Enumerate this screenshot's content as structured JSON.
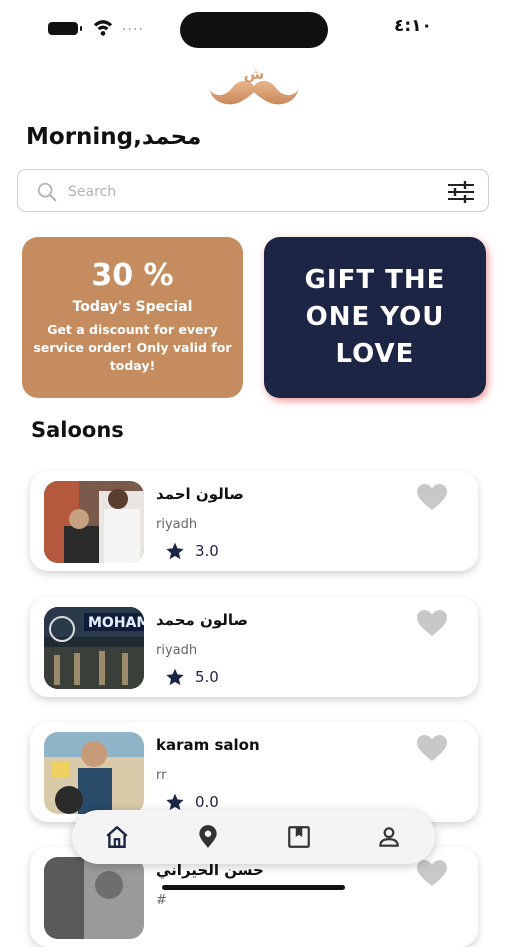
{
  "status_bar": {
    "time": "٤:١٠",
    "signal_dots": "...."
  },
  "header": {
    "greeting": "Morning,محمد"
  },
  "search": {
    "placeholder": "Search",
    "value": ""
  },
  "promos": {
    "discount": {
      "percent": "30 %",
      "title": "Today's Special",
      "description": "Get a discount for every service order! Only valid for today!"
    },
    "gift": {
      "text": "GIFT THE\nONE YOU\nLOVE"
    }
  },
  "section": {
    "title": "Saloons"
  },
  "saloons": [
    {
      "name": "صالون احمد",
      "city": "riyadh",
      "rating": "3.0"
    },
    {
      "name": "صالون محمد",
      "city": "riyadh",
      "rating": "5.0"
    },
    {
      "name": "karam salon",
      "city": "rr",
      "rating": "0.0"
    },
    {
      "name": "حسن الحيراني",
      "city": "#",
      "rating": ""
    }
  ],
  "nav": {
    "items": [
      {
        "icon": "home-icon"
      },
      {
        "icon": "location-icon"
      },
      {
        "icon": "bookmark-icon"
      },
      {
        "icon": "profile-icon"
      }
    ]
  },
  "colors": {
    "brand_tan": "#c58d5f",
    "navy": "#1d2544",
    "heart_gray": "#c8c8c8"
  }
}
